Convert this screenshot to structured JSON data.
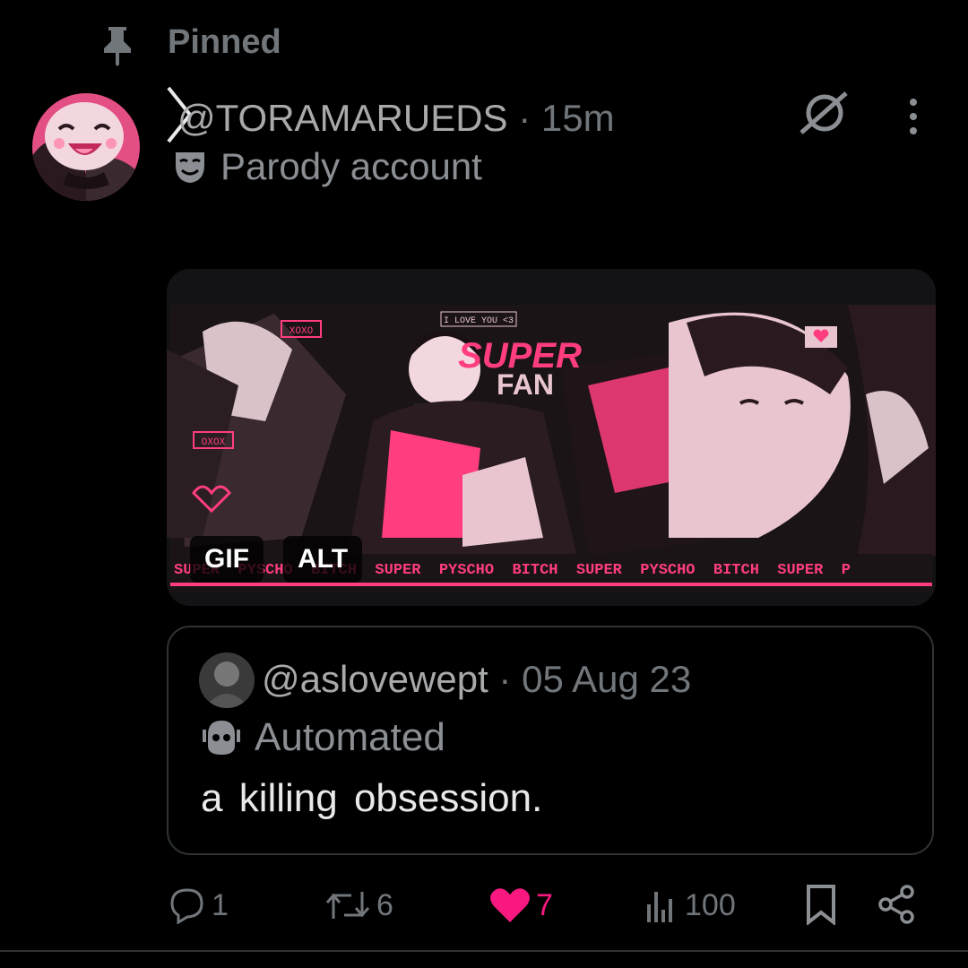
{
  "pinned": {
    "label": "Pinned",
    "icon": "pin-icon"
  },
  "post": {
    "handle": "@TORAMARUEDS",
    "separator": " · ",
    "time": "15m",
    "account_label": "Parody account",
    "account_label_icon": "theater-mask-icon"
  },
  "media": {
    "type": "GIF",
    "gif_badge": "GIF",
    "alt_badge": "ALT",
    "banner_texts": {
      "speech_left": "XOXO",
      "speech_left2": "OXOX",
      "love_tag": "I LOVE YOU <3",
      "title1": "SUPER",
      "title2": "FAN",
      "strip": "SUPER  PYSCHO  BITCH  SUPER  PYSCHO  BITCH  SUPER  PYSCHO  BITCH  SUPER  P"
    },
    "colors": {
      "pink": "#ff3d7f",
      "pale": "#e9c6cf",
      "dark": "#1b1416"
    }
  },
  "quote": {
    "handle": "@aslovewept",
    "separator": " · ",
    "date": "05 Aug 23",
    "account_label": "Automated",
    "account_label_icon": "bot-icon",
    "text": "a  killing  obsession."
  },
  "actions": {
    "replies": "1",
    "reposts": "6",
    "likes": "7",
    "views": "100",
    "like_color": "#f91880"
  }
}
